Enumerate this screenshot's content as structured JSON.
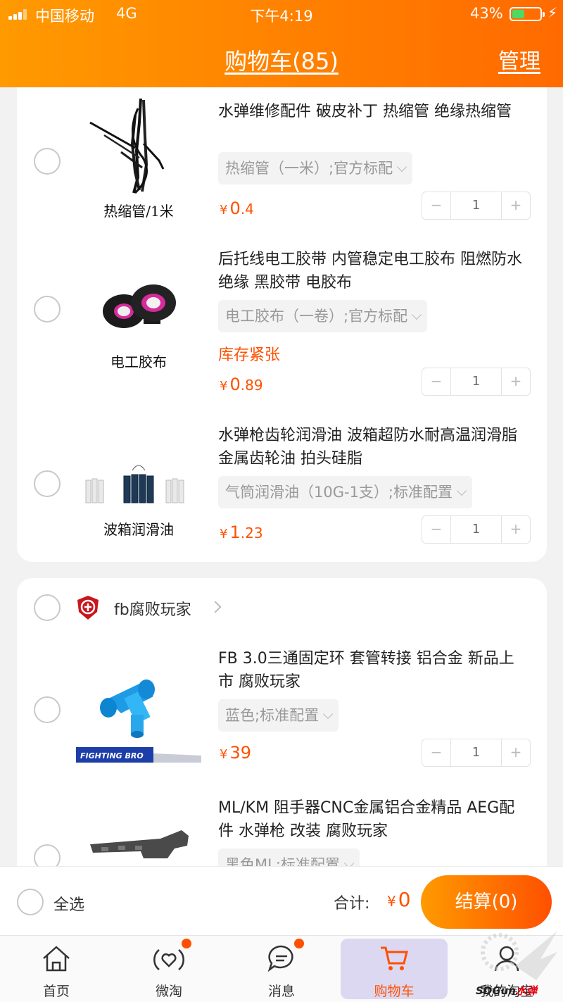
{
  "status_bar": {
    "carrier": "中国移动",
    "network": "4G",
    "time": "下午4:19",
    "battery": "43%"
  },
  "nav": {
    "title": "购物车(85)",
    "manage": "管理"
  },
  "items_group1": [
    {
      "title": "水弹维修配件 破皮补丁 热缩管 绝缘热缩管",
      "sku": "热缩管（一米）;官方标配",
      "price_currency": "¥",
      "price_int": "0",
      "price_dec": ".4",
      "qty": "1",
      "caption": "热缩管/1米"
    },
    {
      "title": "后托线电工胶带 内管稳定电工胶布 阻燃防水绝缘 黑胶带 电胶布",
      "sku": "电工胶布（一卷）;官方标配",
      "stock": "库存紧张",
      "price_currency": "¥",
      "price_int": "0",
      "price_dec": ".89",
      "qty": "1",
      "caption": "电工胶布"
    },
    {
      "title": "水弹枪齿轮润滑油 波箱超防水耐高温润滑脂 金属齿轮油 拍头硅脂",
      "sku": "气筒润滑油（10G-1支）;标准配置",
      "price_currency": "¥",
      "price_int": "1",
      "price_dec": ".23",
      "qty": "1",
      "caption": "波箱润滑油"
    }
  ],
  "shop2": {
    "name": "fb腐败玩家",
    "items": [
      {
        "title": "FB 3.0三通固定环 套管转接 铝合金 新品上市 腐败玩家",
        "sku": "蓝色;标准配置",
        "price_currency": "¥",
        "price_int": "39",
        "price_dec": "",
        "qty": "1",
        "brand": "FIGHTING BRO"
      },
      {
        "title": "ML/KM 阻手器CNC金属铝合金精品 AEG配件 水弹枪 改装 腐败玩家",
        "sku": "黑色ML;标准配置"
      }
    ]
  },
  "checkout": {
    "select_all": "全选",
    "total_label": "合计:",
    "total_currency": "¥",
    "total_value": "0",
    "pay": "结算(0)"
  },
  "tabs": [
    {
      "label": "首页",
      "icon": "home-icon"
    },
    {
      "label": "微淘",
      "icon": "heart-broadcast-icon"
    },
    {
      "label": "消息",
      "icon": "chat-bubble-icon"
    },
    {
      "label": "购物车",
      "icon": "cart-icon"
    },
    {
      "label": "我的淘宝",
      "icon": "profile-icon"
    }
  ],
  "watermark": {
    "prefix": "SDGun",
    "suffix": "水弹"
  },
  "colors": {
    "accent": "#ff5000",
    "header_start": "#ff9a00",
    "header_end": "#ff6a00"
  }
}
